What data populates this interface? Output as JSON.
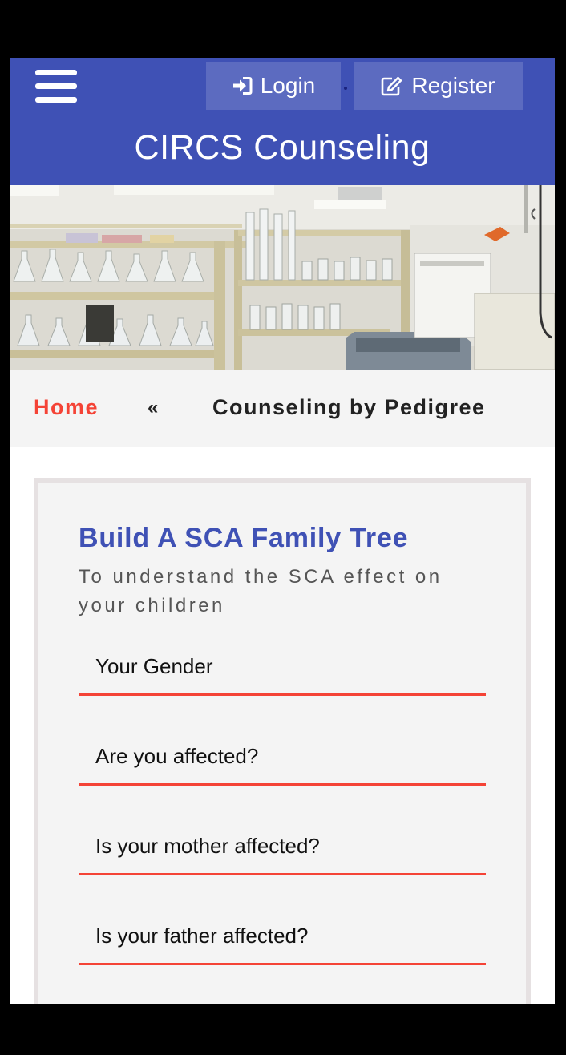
{
  "header": {
    "login_label": "Login",
    "register_label": "Register",
    "site_title": "CIRCS Counseling"
  },
  "breadcrumb": {
    "home": "Home",
    "separator": "«",
    "current": "Counseling by Pedigree"
  },
  "form": {
    "title": "Build A SCA Family Tree",
    "subtitle": "To understand the SCA effect on your children",
    "fields": [
      {
        "label": "Your Gender"
      },
      {
        "label": "Are you affected?"
      },
      {
        "label": "Is your mother affected?"
      },
      {
        "label": "Is your father affected?"
      }
    ]
  },
  "colors": {
    "primary": "#3f51b5",
    "button": "#5c6bc0",
    "accent": "#f44336",
    "panel": "#f4f4f4"
  },
  "icons": {
    "menu": "hamburger-menu-icon",
    "login": "sign-in-icon",
    "register": "edit-icon"
  }
}
